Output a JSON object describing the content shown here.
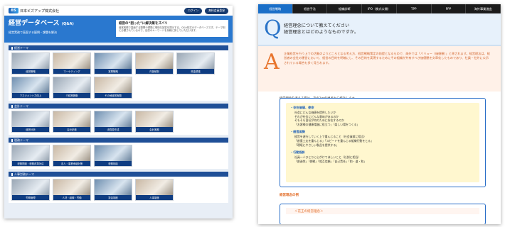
{
  "left": {
    "logo": {
      "mark": "BS",
      "text": "日本ビズアップ株式会社"
    },
    "header_buttons": [
      "ログイン",
      "無料会員登録"
    ],
    "banner": {
      "title": "経営データベース",
      "title_suffix": "(Q&A)",
      "subtitle": "経営実務で直面する疑問・課題を解決",
      "info_heading": "経営の“困った”に解決策をズバリ",
      "info_text": "経営実務で直面する疑問や課題に明快な回答を提示する、Q&A形式のデータベースです。テーマ別に分類されているので、目的のキーワードを気軽に探していただけます。"
    },
    "sections": [
      {
        "title": "経営テーマ",
        "tiles": [
          "経営戦略",
          "マーケティング",
          "営業戦略",
          "内部統制",
          "資金調達",
          "マネジメント力向上",
          "IT経営戦略",
          "その他経営実務"
        ]
      },
      {
        "title": "会計テーマ",
        "tiles": [
          "経営分析",
          "会計記帳",
          "決算書作成",
          "会計実務"
        ]
      },
      {
        "title": "税務テーマ",
        "tiles": [
          "税務関連・税務改革対応",
          "法人・事業承継対策",
          "税務相談"
        ]
      },
      {
        "title": "人事労務テーマ",
        "tiles": [
          "労務管理",
          "人材・組織・労働",
          "賃金制度",
          "人事制度"
        ]
      }
    ]
  },
  "right": {
    "tabs": [
      "経営戦略",
      "経営手法",
      "組織診断",
      "IPO（株式公開）",
      "TPP",
      "PPP",
      "海外事業進出"
    ],
    "active_tab": 0,
    "question": {
      "letter": "Q",
      "line1": "経営理念について教えてください",
      "line2": "経営理念とはどのようなものですか。"
    },
    "answer": {
      "letter": "A",
      "text": "企業経営を行う上での活動のよりどころとなる考え方、経営戦略策定の前提となるもので、海外では「バリュー（価値観）」と称されます。経営理念は、経営者の会社の運営において、経営の目的を明確にし、その目的を実現するためにその組織が共有すべき価値観を文章化したものであり、社員・社外に公示されている場合も多く見られます。"
    },
    "intro": "経営理念を考える際は、次の3つの視点から検討します。",
    "blocks": [
      {
        "heading": "・存在価値、使命",
        "lines": [
          "社会にどんな価値を提供したいか",
          "それが社会にどんな意味があるのか",
          "そもそも自社が何のために存在するのか",
          "「お客様の健康増進に役立つ」「楽しい場をつくる」"
        ]
      },
      {
        "heading": "・経営姿勢",
        "lines": [
          "経営を遂行していく上で重んじること（社会貢献に相当）",
          "「創意工夫を重んじる」「スピードを重んじる組織行動をとる」",
          "「環境にやさしい製品を提供する」"
        ]
      },
      {
        "heading": "・行動指針",
        "lines": [
          "社員一人ひとりに心がけてほしいこと（社訓に相当）",
          "「創造性」「挑戦」「相互信頼」「自己責任」「和・道・和」"
        ]
      }
    ],
    "example_heading": "経営理念の例",
    "example_box": "＜花王の経営理念＞"
  }
}
